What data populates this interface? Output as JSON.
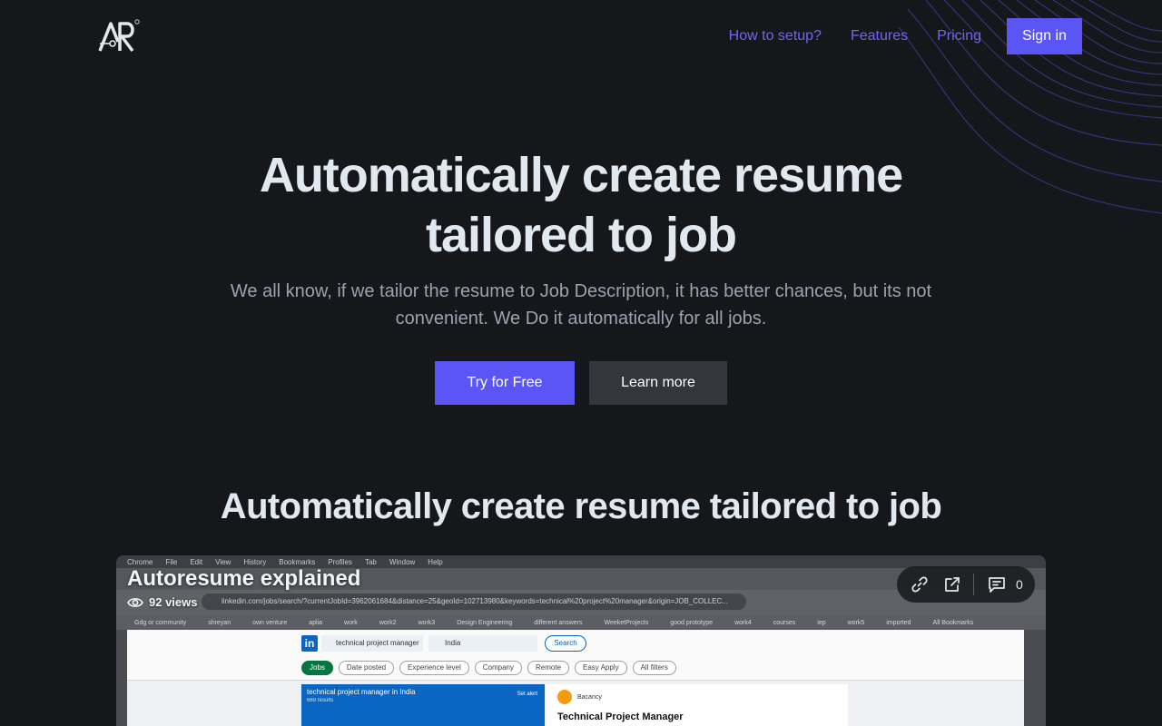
{
  "nav": {
    "links": [
      "How to setup?",
      "Features",
      "Pricing"
    ],
    "signin_label": "Sign in"
  },
  "hero": {
    "title_line1": "Automatically create resume",
    "title_line2": "tailored to job",
    "subtitle": "We all know, if we tailor the resume to Job Description, it has better chances, but its not convenient. We Do it automatically for all jobs.",
    "cta_primary": "Try for Free",
    "cta_secondary": "Learn more"
  },
  "section": {
    "title": "Automatically create resume tailored to job"
  },
  "video": {
    "title": "Autoresume explained",
    "views": "92 views",
    "comments_count": "0",
    "browser": {
      "menu": [
        "Chrome",
        "File",
        "Edit",
        "View",
        "History",
        "Bookmarks",
        "Profiles",
        "Tab",
        "Window",
        "Help"
      ],
      "url": "linkedin.com/jobs/search/?currentJobId=3962061684&distance=25&geoId=102713980&keywords=technical%20project%20manager&origin=JOB_COLLEC...",
      "bookmarks": [
        "Gdg or community",
        "shreyan",
        "own venture",
        "aplia",
        "work",
        "work2",
        "work3",
        "Design Engineering",
        "different answers",
        "WeeketProjects",
        "good prototype",
        "work4",
        "courses",
        "iep",
        "work5",
        "imported"
      ],
      "all_bookmarks": "All Bookmarks",
      "search_query": "technical project manager",
      "location": "India",
      "search_button": "Search",
      "filters": [
        "Jobs",
        "Date posted",
        "Experience level",
        "Company",
        "Remote",
        "Easy Apply",
        "All filters"
      ],
      "list_header": "technical project manager in India",
      "list_count": "669 results",
      "set_alert": "Set alert",
      "company": "Bacancy",
      "job_title": "Technical Project Manager"
    }
  },
  "colors": {
    "background": "#16171b",
    "accent": "#5b55f5",
    "nav_link": "#6f67f0"
  }
}
